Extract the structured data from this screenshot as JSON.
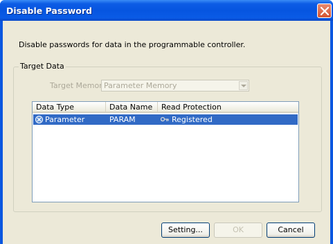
{
  "window": {
    "title": "Disable Password"
  },
  "description": "Disable passwords for data in the programmable controller.",
  "target_data": {
    "group_label": "Target Data",
    "target_memory_label": "Target Memory",
    "target_memory_value": "Parameter Memory"
  },
  "table": {
    "columns": [
      "Data Type",
      "Data Name",
      "Read Protection"
    ],
    "rows": [
      {
        "data_type": "Parameter",
        "data_name": "PARAM",
        "read_protection": "Registered",
        "selected": true
      }
    ]
  },
  "buttons": {
    "setting": "Setting...",
    "ok": "OK",
    "cancel": "Cancel"
  },
  "icons": {
    "close": "close-icon",
    "dropdown": "chevron-down-icon",
    "parameter": "parameter-icon",
    "key": "key-icon"
  },
  "colors": {
    "titlebar": "#0655e0",
    "selection": "#316ac5",
    "client_bg": "#ece9d8"
  }
}
